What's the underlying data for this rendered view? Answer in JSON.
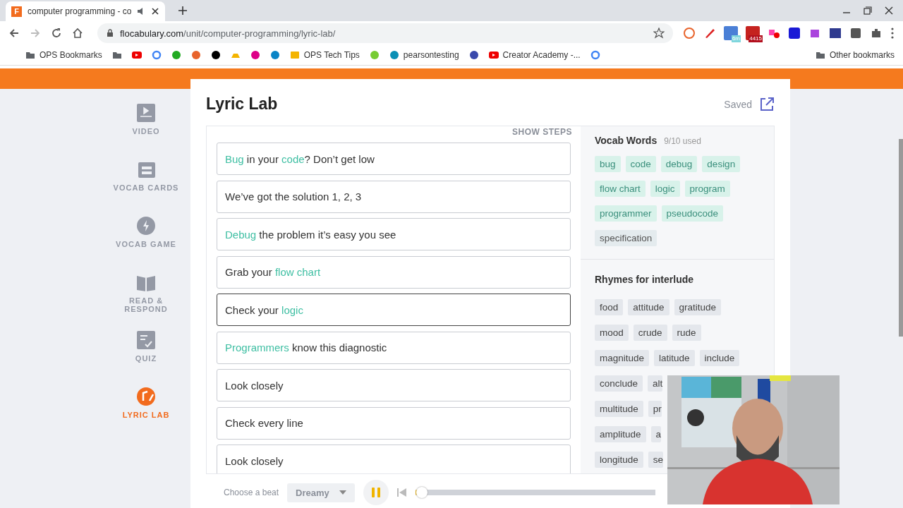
{
  "browser": {
    "tab": {
      "title": "computer programming - co",
      "favicon": "F"
    },
    "url": {
      "host": "flocabulary.com",
      "path": "/unit/computer-programming/lyric-lab/"
    },
    "extension_badges": [
      "6m",
      "4415"
    ],
    "bookmarks": [
      {
        "label": "OPS Bookmarks",
        "kind": "folder"
      },
      {
        "kind": "folder"
      },
      {
        "kind": "youtube"
      },
      {
        "kind": "google"
      },
      {
        "kind": "arrows"
      },
      {
        "kind": "star"
      },
      {
        "kind": "e"
      },
      {
        "kind": "drive"
      },
      {
        "kind": "atom"
      },
      {
        "kind": "ring"
      },
      {
        "label": "OPS Tech Tips",
        "kind": "slides"
      },
      {
        "kind": "frog"
      },
      {
        "label": "pearsontesting",
        "kind": "p"
      },
      {
        "kind": "grid"
      },
      {
        "label": "Creator Academy -...",
        "kind": "youtube"
      },
      {
        "kind": "google"
      }
    ],
    "other_bookmarks": "Other bookmarks"
  },
  "sidebar": [
    {
      "label": "VIDEO",
      "kind": "video",
      "selected": false
    },
    {
      "label": "VOCAB CARDS",
      "kind": "cards",
      "selected": false
    },
    {
      "label": "VOCAB GAME",
      "kind": "game",
      "selected": false
    },
    {
      "label": "READ &\nRESPOND",
      "kind": "book",
      "selected": false
    },
    {
      "label": "QUIZ",
      "kind": "quiz",
      "selected": false
    },
    {
      "label": "LYRIC LAB",
      "kind": "lyric",
      "selected": true
    }
  ],
  "title": "Lyric Lab",
  "saved": "Saved",
  "show_steps": "SHOW STEPS",
  "lyrics": [
    {
      "selected": false,
      "parts": [
        {
          "text": "Bug",
          "vocab": true
        },
        {
          "text": " in your ",
          "vocab": false
        },
        {
          "text": "code",
          "vocab": true
        },
        {
          "text": "? Don’t get low",
          "vocab": false
        }
      ]
    },
    {
      "selected": false,
      "parts": [
        {
          "text": "We’ve got the solution 1, 2, 3",
          "vocab": false
        }
      ]
    },
    {
      "selected": false,
      "parts": [
        {
          "text": "Debug",
          "vocab": true
        },
        {
          "text": " the problem it’s easy you see",
          "vocab": false
        }
      ]
    },
    {
      "selected": false,
      "parts": [
        {
          "text": "Grab your ",
          "vocab": false
        },
        {
          "text": "flow chart",
          "vocab": true
        }
      ]
    },
    {
      "selected": true,
      "parts": [
        {
          "text": "Check your ",
          "vocab": false
        },
        {
          "text": "logic",
          "vocab": true
        }
      ]
    },
    {
      "selected": false,
      "parts": [
        {
          "text": "Programmers",
          "vocab": true
        },
        {
          "text": " know this diagnostic",
          "vocab": false
        }
      ]
    },
    {
      "selected": false,
      "parts": [
        {
          "text": "Look closely",
          "vocab": false
        }
      ]
    },
    {
      "selected": false,
      "parts": [
        {
          "text": "Check every line",
          "vocab": false
        }
      ]
    },
    {
      "selected": false,
      "parts": [
        {
          "text": "Look closely",
          "vocab": false
        }
      ]
    }
  ],
  "vocab": {
    "title": "Vocab Words",
    "count": "9/10 used",
    "words": [
      {
        "text": "bug",
        "used": true
      },
      {
        "text": "code",
        "used": true
      },
      {
        "text": "debug",
        "used": true
      },
      {
        "text": "design",
        "used": true
      },
      {
        "text": "flow chart",
        "used": true
      },
      {
        "text": "logic",
        "used": true
      },
      {
        "text": "program",
        "used": true
      },
      {
        "text": "programmer",
        "used": true
      },
      {
        "text": "pseudocode",
        "used": true
      },
      {
        "text": "specification",
        "used": false
      }
    ]
  },
  "rhymes": {
    "title": "Rhymes for **interlude**",
    "rows": [
      [
        "food",
        "attitude",
        "gratitude"
      ],
      [
        "mood",
        "crude",
        "rude"
      ],
      [
        "magnitude",
        "latitude",
        "include"
      ],
      [
        "conclude",
        "alt"
      ],
      [
        "multitude",
        "pr"
      ],
      [
        "amplitude",
        "a"
      ],
      [
        "longitude",
        "se"
      ]
    ]
  },
  "player": {
    "label": "Choose a beat",
    "beat": "Dreamy",
    "playing": true,
    "level": 0.01
  }
}
